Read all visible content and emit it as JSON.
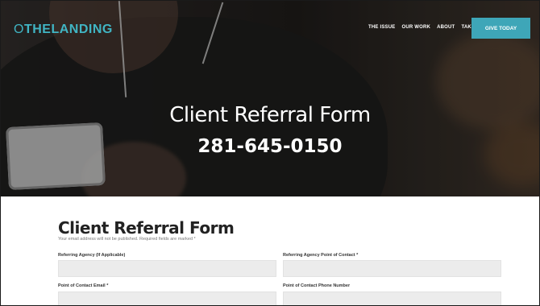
{
  "nav": {
    "logo_prefix": "O",
    "logo_main": "THELANDING",
    "items": [
      {
        "label": "THE ISSUE"
      },
      {
        "label": "OUR WORK"
      },
      {
        "label": "ABOUT"
      },
      {
        "label": "TAKE ACTION"
      }
    ],
    "cta_label": "GIVE TODAY"
  },
  "hero": {
    "title": "Client Referral Form",
    "phone": "281-645-0150"
  },
  "form": {
    "title": "Client Referral Form",
    "note": "Your email address will not be published. Required fields are marked *",
    "fields": [
      {
        "label": "Referring Agency (If Applicable)",
        "value": ""
      },
      {
        "label": "Referring Agency Point of Contact *",
        "value": ""
      },
      {
        "label": "Point of Contact Email *",
        "value": ""
      },
      {
        "label": "Point of Contact Phone Number",
        "value": ""
      }
    ]
  },
  "colors": {
    "accent": "#3ea6b8",
    "logo": "#40b5c4",
    "input_bg": "#ececec"
  }
}
